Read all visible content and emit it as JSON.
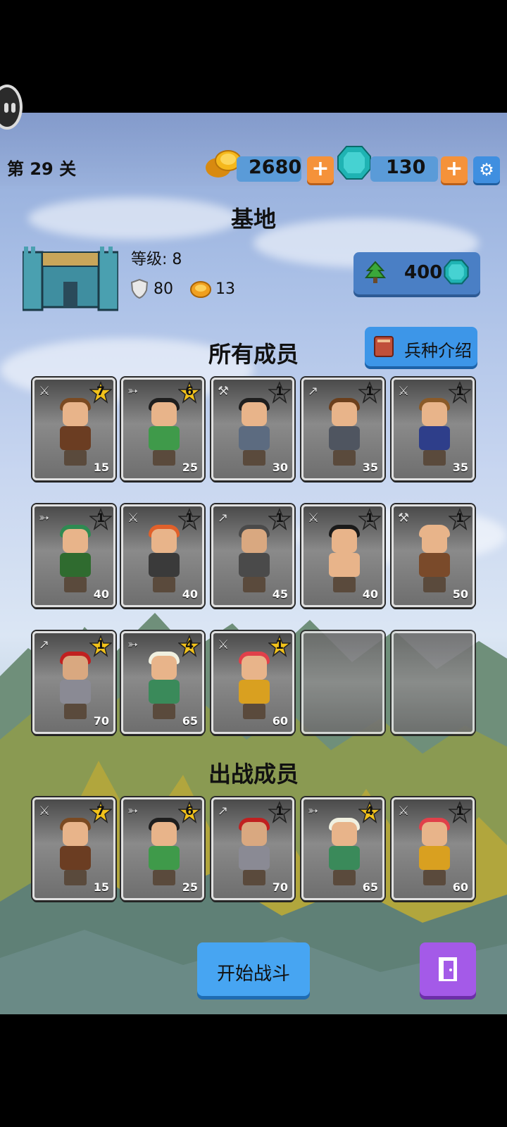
{
  "stage": {
    "label": "第 29 关"
  },
  "resources": {
    "gold": {
      "value": "2680",
      "icon": "gold-coins-icon"
    },
    "gems": {
      "value": "130",
      "icon": "gem-icon"
    },
    "plus_label": "+",
    "settings_icon": "gear-icon"
  },
  "base": {
    "title": "基地",
    "level_text": "等级: 8",
    "defense": "80",
    "income": "13",
    "upgrade_cost": "400",
    "upgrade_icon": "tree-up-icon"
  },
  "all_members": {
    "title": "所有成员",
    "intro_button": "兵种介绍",
    "cards": [
      {
        "weapon": "sword",
        "stars": "7",
        "cost": "15",
        "hair": "#7a4a22",
        "body": "#6b3d22",
        "skin": "#e8b48a"
      },
      {
        "weapon": "bow",
        "stars": "6",
        "cost": "25",
        "hair": "#1e1e1e",
        "body": "#3f9a4a",
        "skin": "#e8b48a"
      },
      {
        "weapon": "axe",
        "stars": "1",
        "cost": "30",
        "hair": "#1e1e1e",
        "body": "#5c6b80",
        "skin": "#e8b48a"
      },
      {
        "weapon": "spear",
        "stars": "1",
        "cost": "35",
        "hair": "#6b3f1c",
        "body": "#4f5560",
        "skin": "#e8b48a"
      },
      {
        "weapon": "sword",
        "stars": "1",
        "cost": "35",
        "hair": "#8a5a28",
        "body": "#2e3e8a",
        "skin": "#e8b48a"
      },
      {
        "weapon": "bow",
        "stars": "1",
        "cost": "40",
        "hair": "#2f8a52",
        "body": "#2f6b2f",
        "skin": "#e8b48a"
      },
      {
        "weapon": "sword",
        "stars": "1",
        "cost": "40",
        "hair": "#e0602a",
        "body": "#3a3a3a",
        "skin": "#e8b48a"
      },
      {
        "weapon": "spear",
        "stars": "1",
        "cost": "45",
        "hair": "#4a4a4a",
        "body": "#4a4a4a",
        "skin": "#d9a880"
      },
      {
        "weapon": "sword",
        "stars": "1",
        "cost": "40",
        "hair": "#1a1a1a",
        "body": "#e8b48a",
        "skin": "#e8b48a"
      },
      {
        "weapon": "axe",
        "stars": "1",
        "cost": "50",
        "hair": "#e8b48a",
        "body": "#7a4a2a",
        "skin": "#e8b48a"
      },
      {
        "weapon": "spear",
        "stars": "1",
        "cost": "70",
        "hair": "#c02020",
        "body": "#8a8a94",
        "skin": "#d9a880",
        "gold_star": true
      },
      {
        "weapon": "bow",
        "stars": "4",
        "cost": "65",
        "hair": "#f0f0e0",
        "body": "#3a8a5a",
        "skin": "#e8b48a",
        "gold_star": true
      },
      {
        "weapon": "sword",
        "stars": "1",
        "cost": "60",
        "hair": "#e0404a",
        "body": "#d9a020",
        "skin": "#e8b48a",
        "gold_star": true
      }
    ],
    "empty_slots": 2
  },
  "battle_members": {
    "title": "出战成员",
    "cards": [
      {
        "weapon": "sword",
        "stars": "7",
        "cost": "15",
        "hair": "#7a4a22",
        "body": "#6b3d22",
        "skin": "#e8b48a"
      },
      {
        "weapon": "bow",
        "stars": "6",
        "cost": "25",
        "hair": "#1e1e1e",
        "body": "#3f9a4a",
        "skin": "#e8b48a"
      },
      {
        "weapon": "spear",
        "stars": "1",
        "cost": "70",
        "hair": "#c02020",
        "body": "#8a8a94",
        "skin": "#d9a880"
      },
      {
        "weapon": "bow",
        "stars": "4",
        "cost": "65",
        "hair": "#f0f0e0",
        "body": "#3a8a5a",
        "skin": "#e8b48a"
      },
      {
        "weapon": "sword",
        "stars": "1",
        "cost": "60",
        "hair": "#e0404a",
        "body": "#d9a020",
        "skin": "#e8b48a"
      }
    ]
  },
  "actions": {
    "start_battle": "开始战斗",
    "exit_icon": "exit-door-icon"
  },
  "colors": {
    "gold_star": "#f2c21a",
    "gray_star": "#5a5a5a",
    "plus_orange": "#f5923a",
    "start_blue": "#47a5f2",
    "exit_purple": "#a45ae8"
  }
}
